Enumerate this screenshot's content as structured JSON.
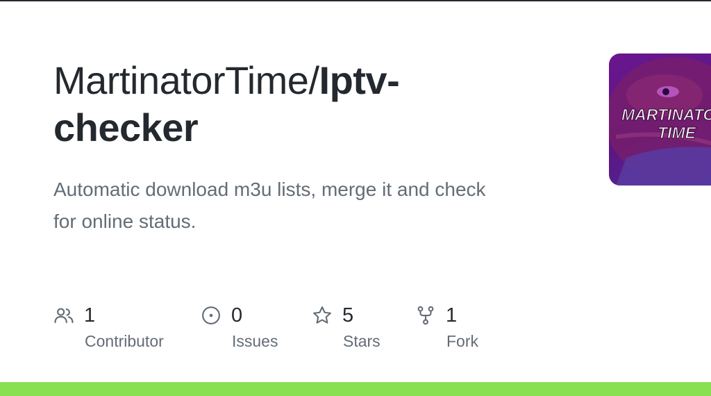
{
  "repo": {
    "owner": "MartinatorTime/",
    "name": "Iptv-checker",
    "name_line1": "Iptv-",
    "name_line2": "checker",
    "description_line1": "Automatic download m3u lists, merge it and check",
    "description_line2": "for online status."
  },
  "avatar": {
    "text_line1": "MARTINATOR",
    "text_line2": "TIME"
  },
  "stats": [
    {
      "icon": "people-icon",
      "value": "1",
      "label": "Contributor"
    },
    {
      "icon": "issue-icon",
      "value": "0",
      "label": "Issues"
    },
    {
      "icon": "star-icon",
      "value": "5",
      "label": "Stars"
    },
    {
      "icon": "fork-icon",
      "value": "1",
      "label": "Fork"
    }
  ],
  "colors": {
    "language_bar": "#89e051",
    "title": "#24292f",
    "muted": "#636c76"
  }
}
